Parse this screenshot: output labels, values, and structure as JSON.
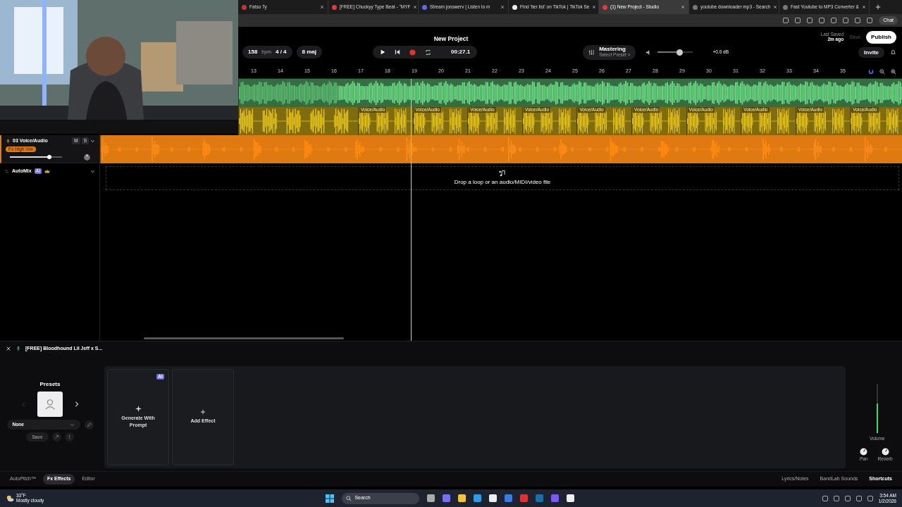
{
  "browser": {
    "tabs": [
      {
        "title": "Fatso Ty",
        "selected": false
      },
      {
        "title": "[FREE] Chuckyy Type Beat - \"MYF",
        "selected": false
      },
      {
        "title": "Stream jonswerv | Listen to m",
        "selected": false
      },
      {
        "title": "Find 'tier list' on TikTok | TikTok Se",
        "selected": false
      },
      {
        "title": "(1) New Project - Studio",
        "selected": true
      },
      {
        "title": "youtube downloader mp3 - Search",
        "selected": false
      },
      {
        "title": "Fast Youtube to MP3 Converter &",
        "selected": false
      }
    ],
    "chat": "Chat"
  },
  "project": {
    "title": "New Project",
    "tempo": "158",
    "tempo_unit": "bpm",
    "time_signature": "4 / 4",
    "key": "8 maj",
    "time": "00:27.1",
    "mastering": "Mastering",
    "mastering_preset": "Select Preset >",
    "master_volume": {
      "level": 0.62,
      "reading": "+0.0 dB"
    },
    "last_saved_label": "Last Saved",
    "last_saved": "2m ago",
    "save": {
      "label": "Save",
      "disabled": true
    },
    "publish": "Publish",
    "invite": "Invite"
  },
  "ruler": [
    "13",
    "14",
    "15",
    "16",
    "17",
    "18",
    "19",
    "20",
    "21",
    "22",
    "23",
    "24",
    "25",
    "26",
    "27",
    "28",
    "29",
    "30",
    "31",
    "32",
    "33",
    "34",
    "35"
  ],
  "tracks": [
    {
      "color": "#6ad883"
    },
    {
      "color": "#e8c51c",
      "clips": [
        "Voice/Audio",
        "Voice/Audio",
        "Voice/Audio",
        "Voice/Audio",
        "Voice/Audio",
        "Voice/Audio",
        "Voice/Audio",
        "Voice/Audio",
        "Voice/Audio",
        "Voice/Audio"
      ]
    },
    {
      "color": "#df7a12",
      "name": "03 Voice/Audio",
      "effect_tag": "Fx High Vox",
      "mute": "M",
      "solo": "S",
      "volume": {
        "level": 0.75
      }
    }
  ],
  "automix": {
    "label": "AutoMix",
    "badge": "AI"
  },
  "drop_hint": "Drop a loop or an audio/MIDI/video file",
  "effects_panel": {
    "track_title": "[FREE] Bloodhound Lil Jeff x S...",
    "presets_label": "Presets",
    "preset_value": "None",
    "save": {
      "label": "Save",
      "disabled": true
    },
    "cards": [
      {
        "kind": "generate",
        "label": "Generate With Prompt",
        "badge": "AI"
      },
      {
        "kind": "add",
        "label": "Add Effect"
      }
    ],
    "volume": {
      "label": "Volume",
      "level": 0.6
    },
    "knobs": [
      "Pan",
      "Reverb"
    ]
  },
  "bottom_tabs": [
    {
      "label": "AutoPitch™",
      "selected": false
    },
    {
      "prefix": "Fx",
      "label": "Effects",
      "selected": true
    },
    {
      "label": "Editor",
      "selected": false
    }
  ],
  "bottom_links": [
    "Lyrics/Notes",
    "BandLab Sounds",
    "Shortcuts"
  ],
  "taskbar": {
    "temperature": "33°F",
    "weather": "Mostly cloudy",
    "search": "Search",
    "time": "3:54 AM",
    "date": "1/2/2026"
  }
}
